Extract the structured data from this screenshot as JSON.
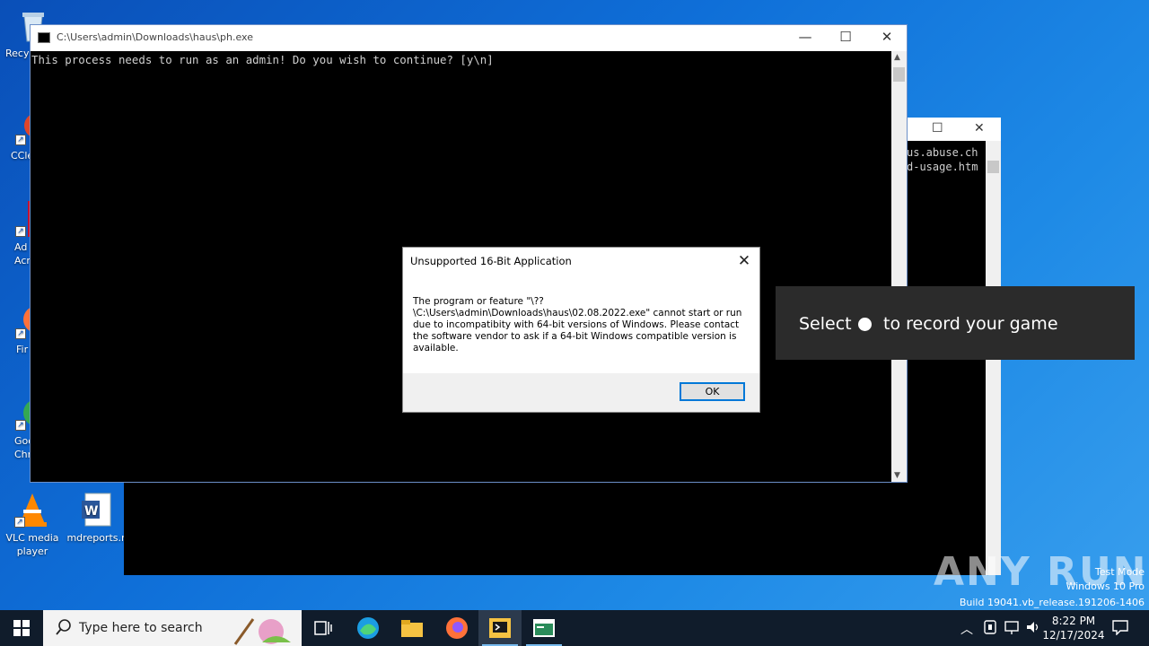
{
  "desktop": {
    "icons": [
      {
        "label": "Recy"
      },
      {
        "label": "CCle"
      },
      {
        "label": "Ad Acr"
      },
      {
        "label": "Fir"
      },
      {
        "label": "Goo Chr"
      },
      {
        "label": "VLC media player"
      },
      {
        "label": "mdreports.r"
      }
    ]
  },
  "back_window": {
    "lines": "us.abuse.ch\nd-usage.htm"
  },
  "main_window": {
    "title": "C:\\Users\\admin\\Downloads\\haus\\ph.exe",
    "console_text": "This process needs to run as an admin! Do you wish to continue? [y\\n]"
  },
  "dialog": {
    "title": "Unsupported 16-Bit Application",
    "message": "The program or feature \"\\??\\C:\\Users\\admin\\Downloads\\haus\\02.08.2022.exe\" cannot start or run due to incompatibity with 64-bit versions of Windows. Please contact the software vendor to ask if a 64-bit Windows compatible version is available.",
    "ok_label": "OK"
  },
  "toast": {
    "before": "Select",
    "after": "to record your game"
  },
  "watermark": {
    "brand": "ANY RUN",
    "line1": "Test Mode",
    "line2": "Windows 10 Pro",
    "line3": "Build 19041.vb_release.191206-1406"
  },
  "taskbar": {
    "search_placeholder": "Type here to search",
    "time": "8:22 PM",
    "date": "12/17/2024"
  }
}
